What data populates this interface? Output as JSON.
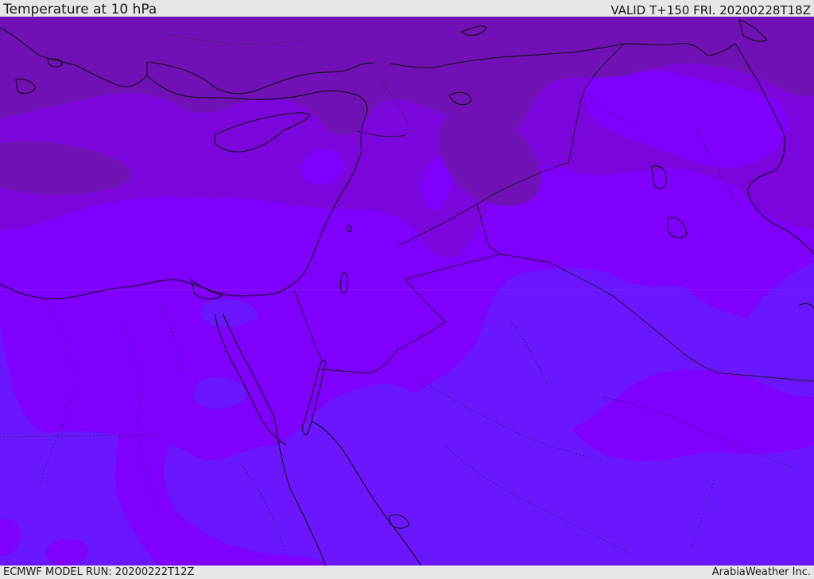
{
  "header": {
    "title": "Temperature at 10 hPa",
    "valid": "VALID T+150 FRI. 20200228T18Z"
  },
  "footer": {
    "model_run": "ECMWF MODEL RUN: 20200222T12Z",
    "credit": "ArabiaWeather Inc."
  },
  "map": {
    "field": "temperature",
    "level": "10 hPa",
    "colors": {
      "warmest_band": "#6f11b4",
      "warm_band": "#7a06dc",
      "mid_band": "#8000ff",
      "cool_band": "#6a16ff",
      "coast_line": "#111111",
      "border_line": "#1a1a1a"
    }
  }
}
